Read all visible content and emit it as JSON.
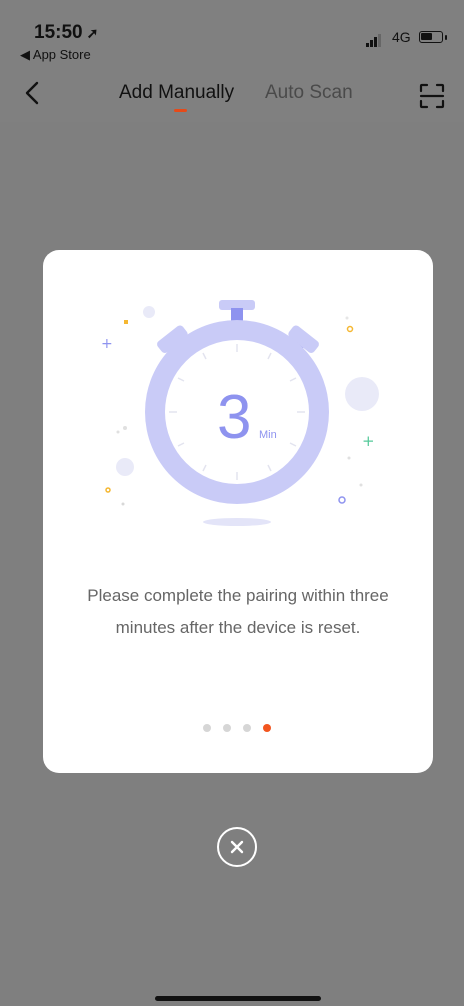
{
  "status_bar": {
    "time": "15:50",
    "back_app": "◀ App Store",
    "network": "4G"
  },
  "nav": {
    "tab_manual": "Add Manually",
    "tab_scan": "Auto Scan"
  },
  "modal": {
    "timer_number": "3",
    "timer_unit": "Min",
    "message_line1": "Please complete the pairing within three",
    "message_line2": "minutes after the device is reset.",
    "page_count": 4,
    "active_page": 4
  },
  "colors": {
    "accent": "#f2551f",
    "timer": "#c9cbf7",
    "timer_dark": "#8e93ef"
  }
}
